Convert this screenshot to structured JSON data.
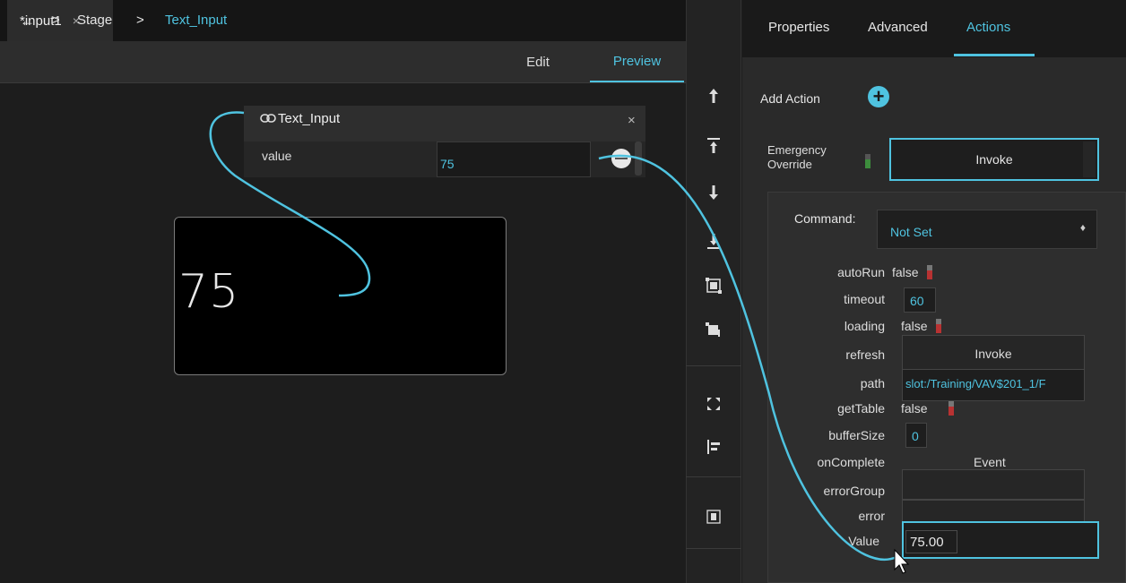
{
  "document_tab": {
    "title": "*input1",
    "close_glyph": "×"
  },
  "breadcrumb": {
    "back_glyph": "←",
    "sep1": ">",
    "stage": "Stage",
    "sep2": ">",
    "current": "Text_Input"
  },
  "modes": {
    "edit": "Edit",
    "preview": "Preview",
    "active": "preview"
  },
  "binding_popup": {
    "title": "Text_Input",
    "close_glyph": "×",
    "row_label": "value",
    "row_value": "75"
  },
  "display_widget": {
    "value": "75"
  },
  "toolbar": {
    "icons": [
      "arrow-up-icon",
      "move-to-top-icon",
      "arrow-down-icon",
      "move-to-bottom-icon",
      "fit-selection-icon",
      "fit-width-icon",
      "expand-icon",
      "align-left-icon",
      "center-icon"
    ]
  },
  "right_panel": {
    "tabs": [
      "Properties",
      "Advanced",
      "Actions"
    ],
    "active_tab": "Actions",
    "add_action_label": "Add Action",
    "emergency_override": {
      "label_line1": "Emergency",
      "label_line2": "Override",
      "button": "Invoke"
    },
    "command": {
      "label": "Command:",
      "selected": "Not Set"
    },
    "properties": [
      {
        "label": "autoRun",
        "value": "false"
      },
      {
        "label": "timeout",
        "value": "60"
      },
      {
        "label": "loading",
        "value": "false"
      },
      {
        "label": "refresh",
        "value": "Invoke"
      },
      {
        "label": "path",
        "value": "slot:/Training/VAV$201_1/F"
      },
      {
        "label": "getTable",
        "value": "false"
      },
      {
        "label": "bufferSize",
        "value": "0"
      },
      {
        "label": "onComplete",
        "value": "Event"
      },
      {
        "label": "errorGroup",
        "value": ""
      },
      {
        "label": "error",
        "value": ""
      },
      {
        "label": "Value",
        "value": "75.00"
      }
    ]
  },
  "colors": {
    "accent": "#4fc3e0",
    "false_led": "#b83232",
    "true_led": "#3d8d3d"
  }
}
